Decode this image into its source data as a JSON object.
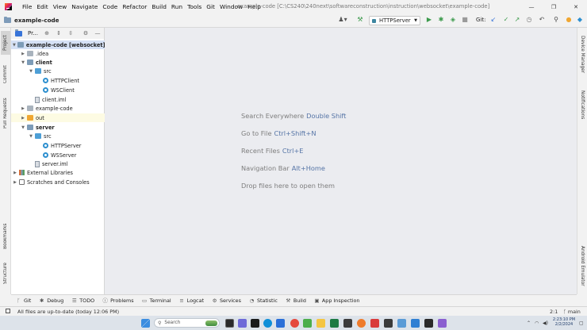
{
  "window": {
    "title": "example-code [C:\\CS240\\240next\\softwareconstruction\\instruction\\websocket\\example-code]",
    "controls": [
      "—",
      "❐",
      "✕"
    ]
  },
  "menu": [
    "File",
    "Edit",
    "View",
    "Navigate",
    "Code",
    "Refactor",
    "Build",
    "Run",
    "Tools",
    "Git",
    "Window",
    "Help"
  ],
  "toolbar": {
    "project_name": "example-code",
    "run_config": "HTTPServer",
    "git_label": "Git:"
  },
  "left_stripe": {
    "project": "Project",
    "commit": "Commit",
    "pull_requests": "Pull Requests",
    "bookmarks": "Bookmarks",
    "structure": "Structure"
  },
  "right_stripe": {
    "device_manager": "Device Manager",
    "notifications": "Notifications",
    "android_emulator": "Android Emulator"
  },
  "project_panel": {
    "title": "Pr...",
    "tree": [
      {
        "label": "example-code [websocket]",
        "suffix": "C",
        "bold": true
      },
      {
        "label": ".idea"
      },
      {
        "label": "client",
        "bold": true
      },
      {
        "label": "src"
      },
      {
        "label": "HTTPClient"
      },
      {
        "label": "WSClient"
      },
      {
        "label": "client.iml"
      },
      {
        "label": "example-code"
      },
      {
        "label": "out"
      },
      {
        "label": "server",
        "bold": true
      },
      {
        "label": "src"
      },
      {
        "label": "HTTPServer"
      },
      {
        "label": "WSServer"
      },
      {
        "label": "server.iml"
      },
      {
        "label": "External Libraries"
      },
      {
        "label": "Scratches and Consoles"
      }
    ]
  },
  "editor_hints": [
    {
      "text": "Search Everywhere",
      "key": "Double Shift"
    },
    {
      "text": "Go to File",
      "key": "Ctrl+Shift+N"
    },
    {
      "text": "Recent Files",
      "key": "Ctrl+E"
    },
    {
      "text": "Navigation Bar",
      "key": "Alt+Home"
    },
    {
      "text": "Drop files here to open them",
      "key": ""
    }
  ],
  "tool_windows": [
    {
      "label": "Git",
      "icon": "branch-icon"
    },
    {
      "label": "Debug",
      "icon": "bug-icon"
    },
    {
      "label": "TODO",
      "icon": "list-icon"
    },
    {
      "label": "Problems",
      "icon": "info-icon"
    },
    {
      "label": "Terminal",
      "icon": "terminal-icon"
    },
    {
      "label": "Logcat",
      "icon": "logcat-icon"
    },
    {
      "label": "Services",
      "icon": "gear-icon"
    },
    {
      "label": "Statistic",
      "icon": "statistic-icon"
    },
    {
      "label": "Build",
      "icon": "hammer-icon"
    },
    {
      "label": "App Inspection",
      "icon": "inspection-icon"
    }
  ],
  "status_bar": {
    "message": "All files are up-to-date (today 12:06 PM)",
    "position": "2:1",
    "branch": "main"
  },
  "taskbar": {
    "search_placeholder": "Search",
    "time": "2:23:10 PM",
    "date": "2/2/2024"
  },
  "colors": {
    "editor_bg": "#ebecf0",
    "selection": "#d5e1f5",
    "hint_key": "#5574a6",
    "run_green": "#3b9a4b"
  }
}
